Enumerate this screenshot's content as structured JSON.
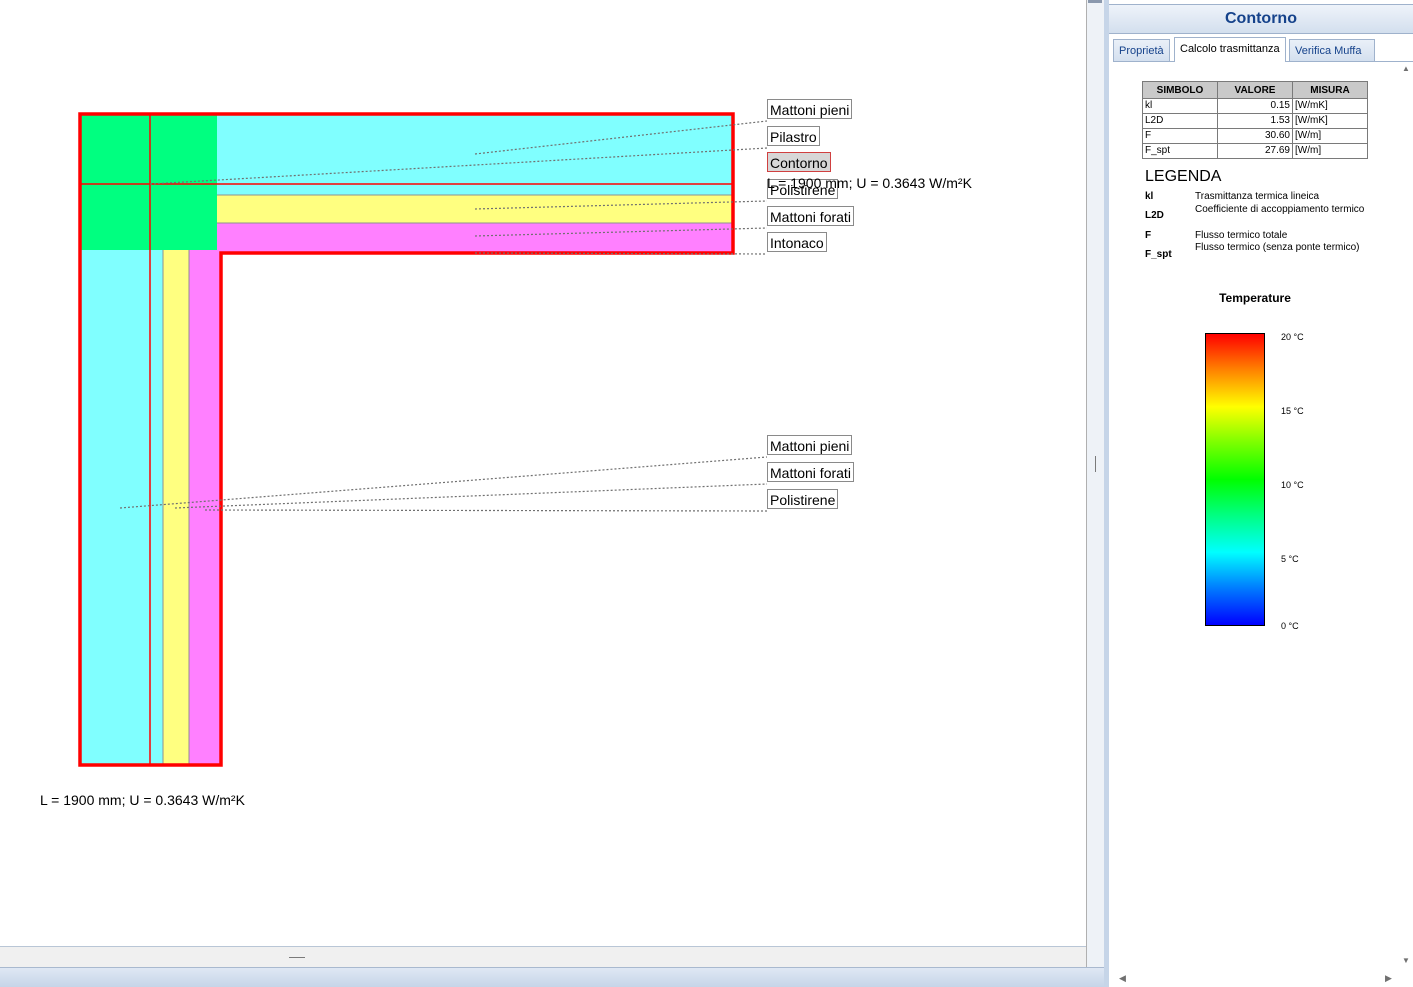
{
  "drawing": {
    "upper_callouts": [
      "Mattoni pieni",
      "Pilastro",
      "Contorno",
      "Polistirene",
      "Mattoni forati",
      "Intonaco"
    ],
    "lower_callouts": [
      "Mattoni pieni",
      "Mattoni forati",
      "Polistirene"
    ],
    "dim_label_top": "L = 1900 mm; U = 0.3643 W/m²K",
    "dim_label_bottom": "L = 1900 mm; U = 0.3643 W/m²K",
    "colors": {
      "mattoni_pieni": "#80ffff",
      "pilastro": "#00ff80",
      "polistirene": "#ffff80",
      "intonaco": "#ff80ff",
      "contorno": "#ff0000"
    }
  },
  "panel": {
    "title": "Contorno",
    "tabs": [
      "Proprietà",
      "Calcolo trasmittanza",
      "Verifica Muffa"
    ],
    "active_tab": "Calcolo trasmittanza",
    "table": {
      "headers": [
        "SIMBOLO",
        "VALORE",
        "MISURA"
      ],
      "rows": [
        [
          "kl",
          "0.15",
          "[W/mK]"
        ],
        [
          "L2D",
          "1.53",
          "[W/mK]"
        ],
        [
          "F",
          "30.60",
          "[W/m]"
        ],
        [
          "F_spt",
          "27.69",
          "[W/m]"
        ]
      ]
    },
    "legend": {
      "title": "LEGENDA",
      "items": [
        {
          "symbol": "kl",
          "description": "Trasmittanza termica lineica"
        },
        {
          "symbol": "L2D",
          "description": "Coefficiente di accoppiamento termico"
        },
        {
          "symbol": "F",
          "description": "Flusso termico totale"
        },
        {
          "symbol": "F_spt",
          "description": "Flusso termico (senza ponte termico)"
        }
      ]
    },
    "temperature": {
      "title": "Temperature",
      "ticks": [
        "20 °C",
        "15 °C",
        "10 °C",
        "5 °C",
        "0 °C"
      ]
    }
  }
}
